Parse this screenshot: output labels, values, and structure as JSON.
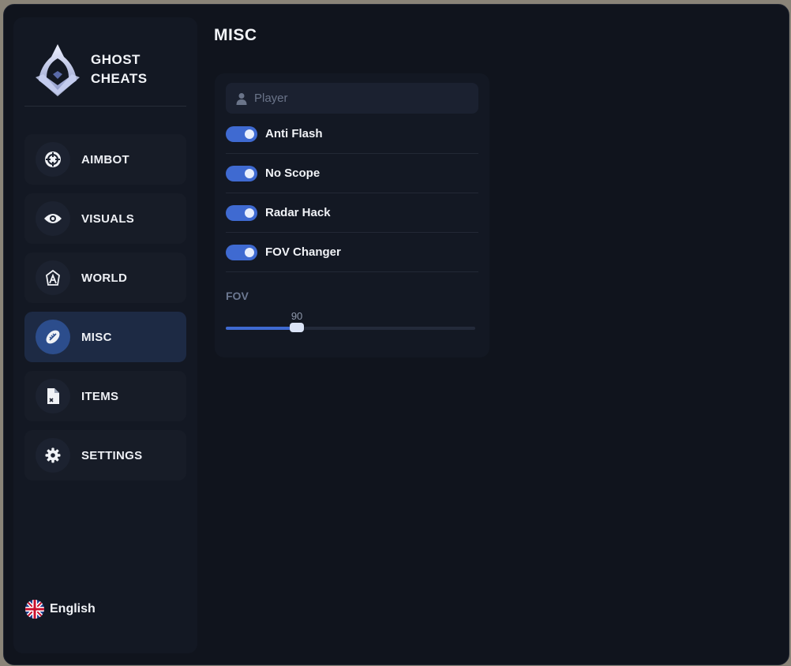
{
  "brand": {
    "line1": "GHOST",
    "line2": "CHEATS"
  },
  "sidebar": {
    "items": [
      {
        "label": "AIMBOT",
        "icon": "crosshair-icon",
        "active": false
      },
      {
        "label": "VISUALS",
        "icon": "eye-icon",
        "active": false
      },
      {
        "label": "WORLD",
        "icon": "world-icon",
        "active": false
      },
      {
        "label": "MISC",
        "icon": "football-icon",
        "active": true
      },
      {
        "label": "ITEMS",
        "icon": "file-icon",
        "active": false
      },
      {
        "label": "SETTINGS",
        "icon": "gear-icon",
        "active": false
      }
    ],
    "language": {
      "label": "English",
      "icon": "uk-flag-icon"
    }
  },
  "page": {
    "title": "MISC"
  },
  "misc": {
    "search": {
      "placeholder": "Player",
      "value": ""
    },
    "toggles": [
      {
        "label": "Anti Flash",
        "enabled": true
      },
      {
        "label": "No Scope",
        "enabled": true
      },
      {
        "label": "Radar Hack",
        "enabled": true
      },
      {
        "label": "FOV Changer",
        "enabled": true
      }
    ],
    "fov": {
      "label": "FOV",
      "value": 90,
      "value_text": "90",
      "fraction": 0.285
    }
  },
  "colors": {
    "accent": "#3f6ad1",
    "active_nav": "#1d2a44",
    "background": "#10141d",
    "panel": "#131823"
  }
}
